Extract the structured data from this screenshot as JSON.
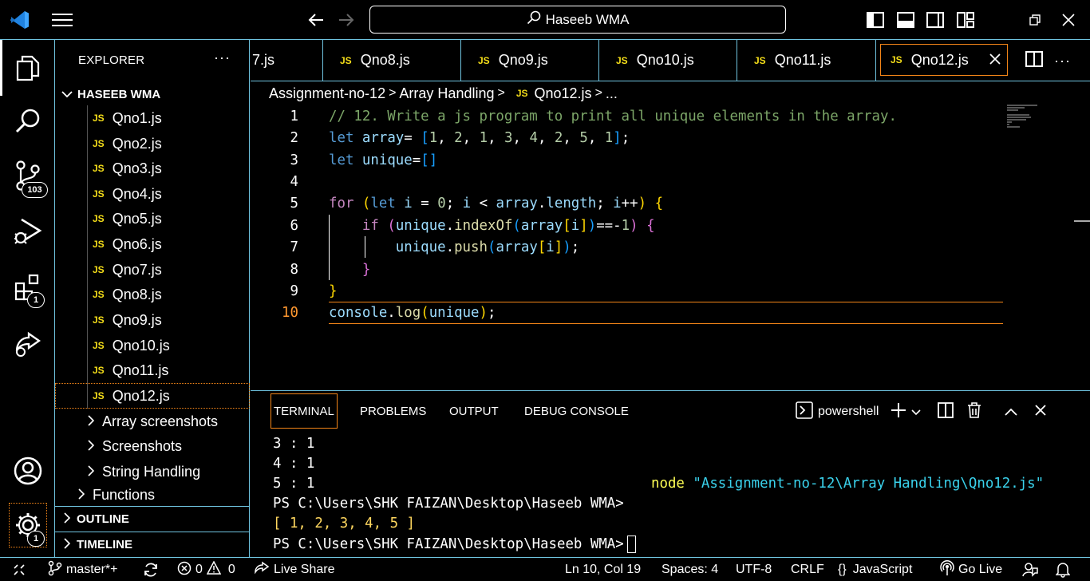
{
  "titlebar": {
    "search_text": "Haseeb WMA"
  },
  "activitybar": {
    "source_control_badge": "103",
    "extensions_badge": "1",
    "settings_badge": "1"
  },
  "sidebar": {
    "title": "EXPLORER",
    "more": "···",
    "folder": "HASEEB WMA",
    "files": [
      "Qno1.js",
      "Qno2.js",
      "Qno3.js",
      "Qno4.js",
      "Qno5.js",
      "Qno6.js",
      "Qno7.js",
      "Qno8.js",
      "Qno9.js",
      "Qno10.js",
      "Qno11.js",
      "Qno12.js"
    ],
    "file_badge": "JS",
    "subfolders": [
      "Array screenshots",
      "Screenshots",
      "String Handling"
    ],
    "functions": "Functions",
    "outline": "OUTLINE",
    "timeline": "TIMELINE"
  },
  "tabs": {
    "items": [
      "7.js",
      "Qno8.js",
      "Qno9.js",
      "Qno10.js",
      "Qno11.js",
      "Qno12.js"
    ],
    "active": "Qno12.js",
    "badge": "JS",
    "more": "···"
  },
  "breadcrumb": {
    "parts": [
      "Assignment-no-12",
      "Array Handling",
      "Qno12.js",
      "..."
    ],
    "sep": ">"
  },
  "editor": {
    "line_numbers": [
      "1",
      "2",
      "3",
      "4",
      "5",
      "6",
      "7",
      "8",
      "9",
      "10"
    ],
    "current_line": "10"
  },
  "panel": {
    "tabs": [
      "TERMINAL",
      "PROBLEMS",
      "OUTPUT",
      "DEBUG CONSOLE"
    ],
    "shell": "powershell",
    "lines": [
      "3 : 1",
      "4 : 1",
      "5 : 1",
      "PS C:\\Users\\SHK FAIZAN\\Desktop\\Haseeb WMA>",
      "[ 1, 2, 3, 4, 5 ]",
      "PS C:\\Users\\SHK FAIZAN\\Desktop\\Haseeb WMA>"
    ],
    "node_cmd": "node",
    "node_arg": "\"Assignment-no-12\\Array Handling\\Qno12.js\""
  },
  "statusbar": {
    "branch": "master*+",
    "errors": "0",
    "warnings": "0",
    "live_share": "Live Share",
    "position": "Ln 10, Col 19",
    "spaces": "Spaces: 4",
    "encoding": "UTF-8",
    "eol": "CRLF",
    "language": "JavaScript",
    "go_live": "Go Live"
  }
}
